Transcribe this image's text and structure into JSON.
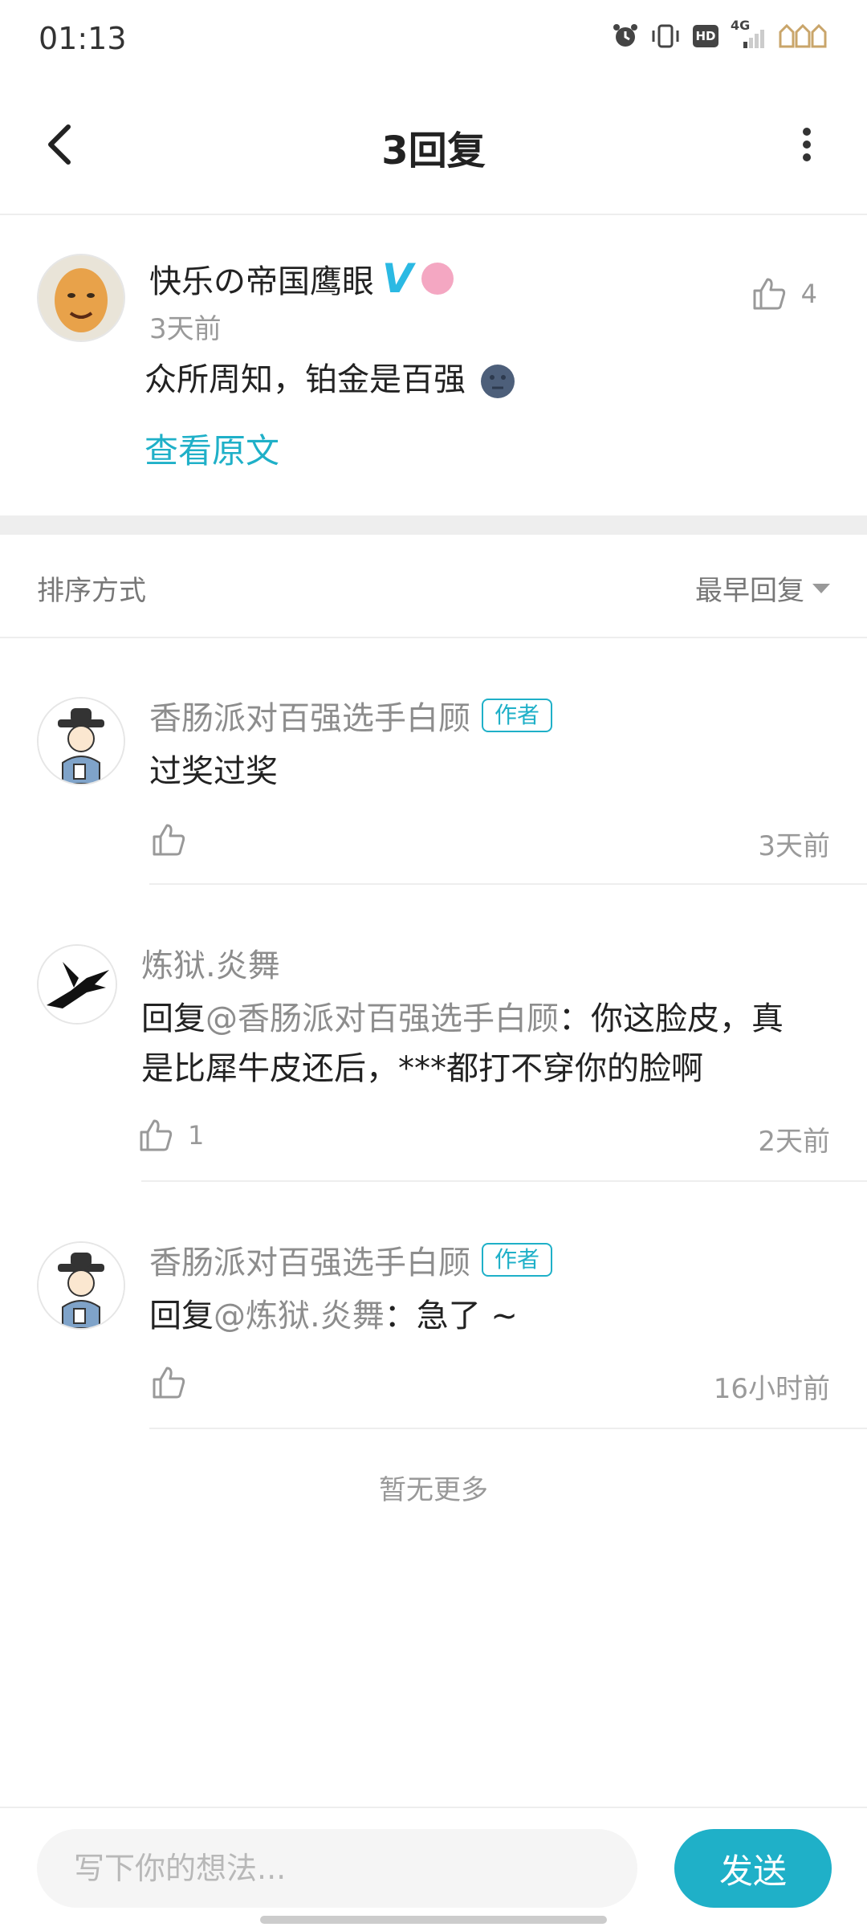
{
  "status_bar": {
    "time": "01:13",
    "icons": [
      "alarm-icon",
      "vibrate-icon",
      "hd-icon",
      "signal-4g-icon",
      "battery-icon"
    ],
    "hd_label": "HD",
    "network_label": "4G"
  },
  "header": {
    "title": "3回复"
  },
  "original_comment": {
    "author": "快乐の帝国鹰眼",
    "verified_mark": "V",
    "time": "3天前",
    "text": "众所周知，铂金是百强",
    "like_count": "4",
    "view_original": "查看原文"
  },
  "sort": {
    "label": "排序方式",
    "selected": "最早回复"
  },
  "replies": [
    {
      "author": "香肠派对百强选手白顾",
      "tag": "作者",
      "text": "过奖过奖",
      "like_count": "",
      "time": "3天前"
    },
    {
      "author": "炼狱.炎舞",
      "reply_prefix": "回复",
      "mention": "@香肠派对百强选手白顾",
      "text_line1": "：你这脸皮，真",
      "text_line2": "是比犀牛皮还后，***都打不穿你的脸啊",
      "like_count": "1",
      "time": "2天前"
    },
    {
      "author": "香肠派对百强选手白顾",
      "tag": "作者",
      "reply_prefix": "回复",
      "mention": "@炼狱.炎舞",
      "text": "：急了 ~",
      "like_count": "",
      "time": "16小时前"
    }
  ],
  "footer_note": "暂无更多",
  "composer": {
    "placeholder": "写下你的想法...",
    "send_label": "发送"
  },
  "colors": {
    "accent": "#1fb0c8",
    "verified": "#2bb9e3",
    "gray_text": "#8d8d8d"
  }
}
